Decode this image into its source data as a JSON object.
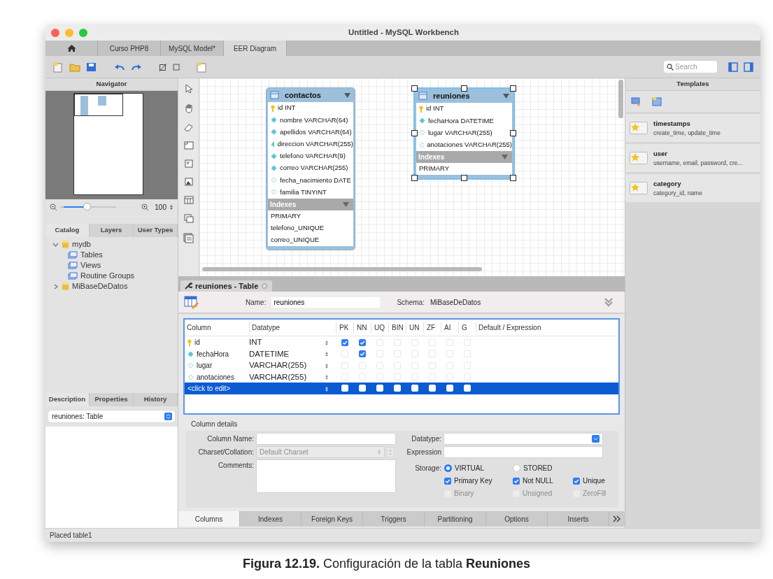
{
  "window": {
    "title": "Untitled - MySQL Workbench"
  },
  "tabs": [
    {
      "kind": "home",
      "selected": false
    },
    {
      "kind": "text",
      "label": "Curso PHP8",
      "selected": false
    },
    {
      "kind": "text",
      "label": "MySQL Model*",
      "selected": false
    },
    {
      "kind": "text",
      "label": "EER Diagram",
      "selected": true
    }
  ],
  "search": {
    "placeholder": "Search"
  },
  "navigator": {
    "title": "Navigator",
    "zoom": {
      "level": 0.47,
      "value": "100"
    }
  },
  "catalog_tabs": [
    {
      "label": "Catalog",
      "selected": true
    },
    {
      "label": "Layers",
      "selected": false
    },
    {
      "label": "User Types",
      "selected": false
    }
  ],
  "catalog_tree": [
    {
      "kind": "schema",
      "label": "mydb",
      "expanded": true,
      "children": [
        {
          "kind": "group",
          "label": "Tables"
        },
        {
          "kind": "group",
          "label": "Views"
        },
        {
          "kind": "group",
          "label": "Routine Groups"
        }
      ]
    },
    {
      "kind": "schema",
      "label": "MiBaseDeDatos",
      "expanded": false
    }
  ],
  "info_tabs": [
    {
      "label": "Description",
      "selected": true
    },
    {
      "label": "Properties",
      "selected": false
    },
    {
      "label": "History",
      "selected": false
    }
  ],
  "info_select": {
    "value": "reuniones: Table"
  },
  "diagram": {
    "tables": [
      {
        "name": "contactos",
        "selected": false,
        "columns": [
          {
            "text": "id INT",
            "kind": "pk"
          },
          {
            "text": "nombre VARCHAR(64)",
            "kind": "nn"
          },
          {
            "text": "apellidos VARCHAR(64)",
            "kind": "nn"
          },
          {
            "text": "direccion VARCHAR(255)",
            "kind": "nn"
          },
          {
            "text": "telefono VARCHAR(9)",
            "kind": "nn"
          },
          {
            "text": "correo VARCHAR(255)",
            "kind": "nn"
          },
          {
            "text": "fecha_nacimiento DATE",
            "kind": "null"
          },
          {
            "text": "familia TINYINT",
            "kind": "null"
          }
        ],
        "indexes_label": "Indexes",
        "indexes": [
          "PRIMARY",
          "telefono_UNIQUE",
          "correo_UNIQUE"
        ]
      },
      {
        "name": "reuniones",
        "selected": true,
        "columns": [
          {
            "text": "id INT",
            "kind": "pk"
          },
          {
            "text": "fechaHora DATETIME",
            "kind": "nn"
          },
          {
            "text": "lugar VARCHAR(255)",
            "kind": "null"
          },
          {
            "text": "anotaciones VARCHAR(255)",
            "kind": "null"
          }
        ],
        "indexes_label": "Indexes",
        "indexes": [
          "PRIMARY"
        ]
      }
    ]
  },
  "templates": {
    "title": "Templates",
    "items": [
      {
        "name": "timestamps",
        "fields": "create_time, update_time"
      },
      {
        "name": "user",
        "fields": "username, email, password, cre..."
      },
      {
        "name": "category",
        "fields": "category_id, name"
      }
    ]
  },
  "editor": {
    "tab": "reuniones - Table",
    "name_label": "Name:",
    "name": "reuniones",
    "schema_label": "Schema:",
    "schema": "MiBaseDeDatos",
    "grid": {
      "columns": [
        "Column",
        "Datatype",
        "PK",
        "NN",
        "UQ",
        "BIN",
        "UN",
        "ZF",
        "AI",
        "G",
        "Default / Expression"
      ],
      "rows": [
        {
          "name": "id",
          "kind": "pk",
          "datatype": "INT",
          "flags": [
            true,
            true,
            false,
            false,
            false,
            false,
            false,
            false
          ],
          "selected": false
        },
        {
          "name": "fechaHora",
          "kind": "nn",
          "datatype": "DATETIME",
          "flags": [
            false,
            true,
            false,
            false,
            false,
            false,
            false,
            false
          ],
          "selected": false
        },
        {
          "name": "lugar",
          "kind": "null",
          "datatype": "VARCHAR(255)",
          "flags": [
            false,
            false,
            false,
            false,
            false,
            false,
            false,
            false
          ],
          "selected": false
        },
        {
          "name": "anotaciones",
          "kind": "null",
          "datatype": "VARCHAR(255)",
          "flags": [
            false,
            false,
            false,
            false,
            false,
            false,
            false,
            false
          ],
          "selected": false
        },
        {
          "name": "<click to edit>",
          "kind": "new",
          "flags": [
            false,
            false,
            false,
            false,
            false,
            false,
            false,
            false
          ],
          "selected": true
        }
      ]
    },
    "details": {
      "title": "Column details",
      "column_name_label": "Column Name:",
      "charset_label": "Charset/Collation:",
      "charset_placeholder": "Default Charset",
      "comments_label": "Comments:",
      "datatype_label": "Datatype:",
      "expression_label": "Expression",
      "storage_label": "Storage:",
      "storage": [
        {
          "label": "VIRTUAL",
          "selected": true
        },
        {
          "label": "STORED",
          "selected": false
        }
      ],
      "options": [
        {
          "label": "Primary Key",
          "checked": true,
          "disabled": false
        },
        {
          "label": "Not NULL",
          "checked": true,
          "disabled": false
        },
        {
          "label": "Unique",
          "checked": true,
          "disabled": false
        },
        {
          "label": "Binary",
          "checked": false,
          "disabled": true
        },
        {
          "label": "Unsigned",
          "checked": false,
          "disabled": true
        },
        {
          "label": "ZeroFill",
          "checked": false,
          "disabled": true
        }
      ]
    },
    "bottom_tabs": [
      {
        "label": "Columns",
        "selected": true
      },
      {
        "label": "Indexes",
        "selected": false
      },
      {
        "label": "Foreign Keys",
        "selected": false
      },
      {
        "label": "Triggers",
        "selected": false
      },
      {
        "label": "Partitioning",
        "selected": false
      },
      {
        "label": "Options",
        "selected": false
      },
      {
        "label": "Inserts",
        "selected": false
      }
    ]
  },
  "status_bar": "Placed table1",
  "caption": "**Figura 12.19.** Configuración de la tabla **Reuniones**"
}
